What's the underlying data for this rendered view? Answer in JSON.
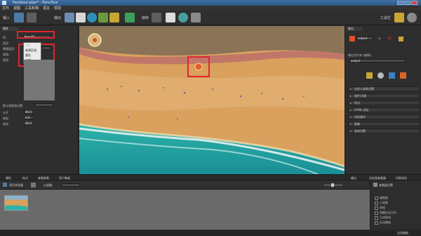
{
  "window": {
    "title": "Panotour.pkpr* - PanoTour"
  },
  "menu": [
    "文件",
    "视图",
    "工具和相",
    "语言",
    "帮助"
  ],
  "toolbar": {
    "left_label": "输入",
    "group1_label": "输出",
    "group2_label": "旋转",
    "right_label": "工具栏"
  },
  "left_panel": {
    "tab_label": "属性",
    "field_label_id": "ID:",
    "field_value_id": "Pano01",
    "field_label_type": "类型:",
    "field_label_model": "建模类型:",
    "field_label_angle": "视角:",
    "field_label_rotate": "预览:",
    "dropdown_options": [
      "球形",
      "新建区域",
      "圆柱",
      "立体"
    ],
    "field_label_init": "默认视角和位置:",
    "field_label_pan": "水平",
    "field_label_tilt": "倾斜",
    "field_label_fov": "视场",
    "pan_value": "90.0",
    "tilt_value": "0.0",
    "fov_value": "90.0"
  },
  "right_panel": {
    "tab_label": "输出",
    "output_name": "output",
    "output_folder_label": "输出文件夹 (编辑):",
    "output_folder_value": "output",
    "sections": [
      "自定义皮肤设置",
      "插件/功能",
      "热点",
      "HTML 浏览",
      "浏览操作",
      "图像",
      "其他设置"
    ]
  },
  "bottom_tabs": {
    "tab1": "属性",
    "tab2": "热点",
    "tab3": "查看参数",
    "tab4": "用户数据",
    "tab5": "输出",
    "tab6": "设定值查看器",
    "tab7": "列表浏览"
  },
  "bottom_toolbar": {
    "browser_label": "项目浏览器",
    "filter_label": "过滤器:",
    "settings_label": "查看器设置"
  },
  "checkboxes": [
    "缩略图",
    "小地图",
    "网格",
    "隐藏自动方向",
    "立体影响",
    "自动播放"
  ],
  "status": {
    "text": "自动播放"
  },
  "colors": {
    "accent_red": "#e0262e",
    "ocean": "#1f9ea0",
    "sand": "#d9a05e"
  }
}
